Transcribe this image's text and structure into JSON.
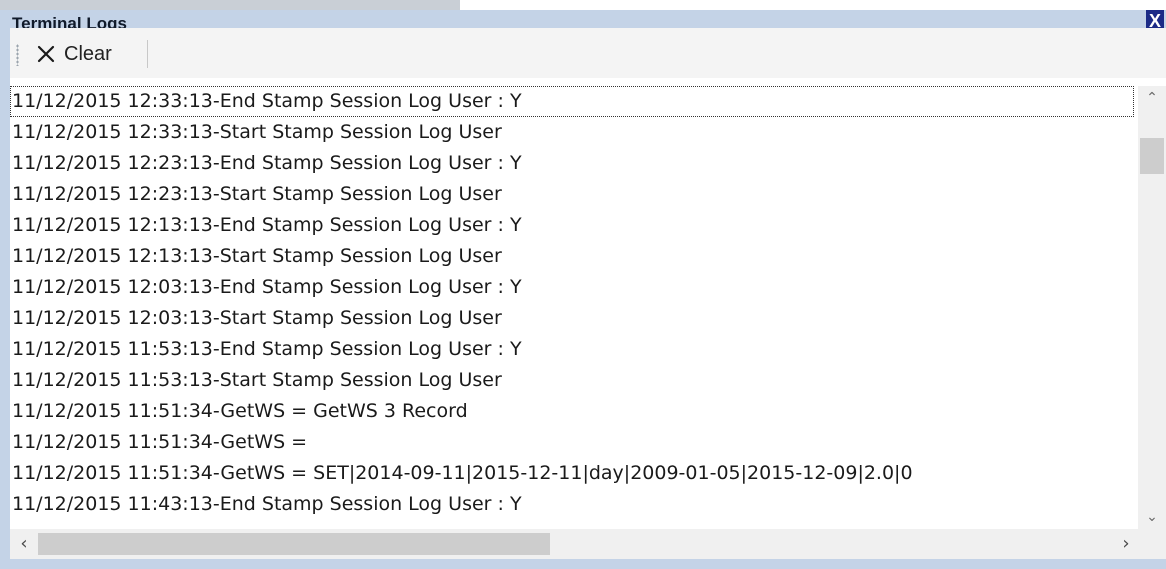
{
  "window": {
    "title": "Terminal Logs",
    "close_label": "X"
  },
  "toolbar": {
    "clear_label": "Clear"
  },
  "logs": [
    "11/12/2015 12:33:13-End Stamp Session Log User : Y",
    "11/12/2015 12:33:13-Start Stamp Session Log User",
    "11/12/2015 12:23:13-End Stamp Session Log User : Y",
    "11/12/2015 12:23:13-Start Stamp Session Log User",
    "11/12/2015 12:13:13-End Stamp Session Log User : Y",
    "11/12/2015 12:13:13-Start Stamp Session Log User",
    "11/12/2015 12:03:13-End Stamp Session Log User : Y",
    "11/12/2015 12:03:13-Start Stamp Session Log User",
    "11/12/2015 11:53:13-End Stamp Session Log User : Y",
    "11/12/2015 11:53:13-Start Stamp Session Log User",
    "11/12/2015 11:51:34-GetWS = GetWS 3 Record",
    "11/12/2015 11:51:34-GetWS =",
    "11/12/2015 11:51:34-GetWS = SET|2014-09-11|2015-12-11|day|2009-01-05|2015-12-09|2.0|0",
    "11/12/2015 11:43:13-End Stamp Session Log User : Y"
  ],
  "colors": {
    "panel": "#c4d3e7",
    "close": "#1b2a86"
  },
  "icons": {
    "clear": "close-x-icon"
  }
}
